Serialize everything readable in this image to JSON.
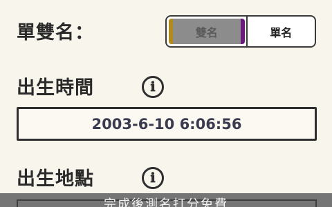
{
  "name_type": {
    "label": "單雙名：",
    "options": [
      "雙名",
      "單名"
    ],
    "selected": "雙名"
  },
  "birth_time": {
    "label": "出生時間",
    "value": "2003-6-10 6:06:56"
  },
  "birth_place": {
    "label": "出生地點"
  },
  "bottom_bar": {
    "text": "完成後測名打分免費"
  },
  "icons": {
    "info": "ℹ"
  },
  "colors": {
    "background": "#f8f5ec",
    "bottom_bar": "#757575"
  }
}
